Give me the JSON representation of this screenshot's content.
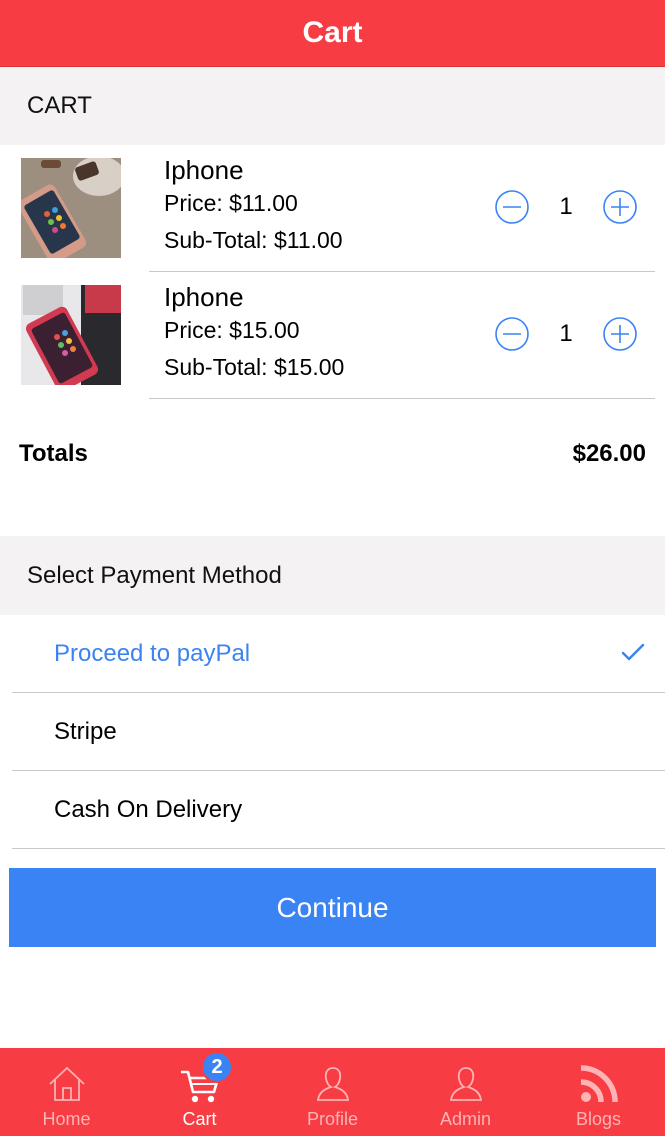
{
  "navbar": {
    "title": "Cart"
  },
  "cart": {
    "header": "CART",
    "items": [
      {
        "name": "Iphone",
        "price": "Price: $11.00",
        "subtotal": "Sub-Total: $11.00",
        "quantity": "1"
      },
      {
        "name": "Iphone",
        "price": "Price: $15.00",
        "subtotal": "Sub-Total: $15.00",
        "quantity": "1"
      }
    ],
    "totals_label": "Totals",
    "totals_value": "$26.00"
  },
  "payment": {
    "header": "Select Payment Method",
    "options": [
      {
        "label": "Proceed to payPal",
        "selected": true
      },
      {
        "label": "Stripe",
        "selected": false
      },
      {
        "label": "Cash On Delivery",
        "selected": false
      }
    ],
    "continue_label": "Continue"
  },
  "tabbar": {
    "items": [
      {
        "label": "Home",
        "icon": "home-icon"
      },
      {
        "label": "Cart",
        "icon": "cart-icon",
        "badge": "2"
      },
      {
        "label": "Profile",
        "icon": "profile-icon"
      },
      {
        "label": "Admin",
        "icon": "admin-icon"
      },
      {
        "label": "Blogs",
        "icon": "rss-icon"
      }
    ],
    "active": "Cart"
  },
  "colors": {
    "primary_red": "#f73c43",
    "accent_blue": "#3a83f4",
    "section_bg": "#f4f2f2"
  }
}
